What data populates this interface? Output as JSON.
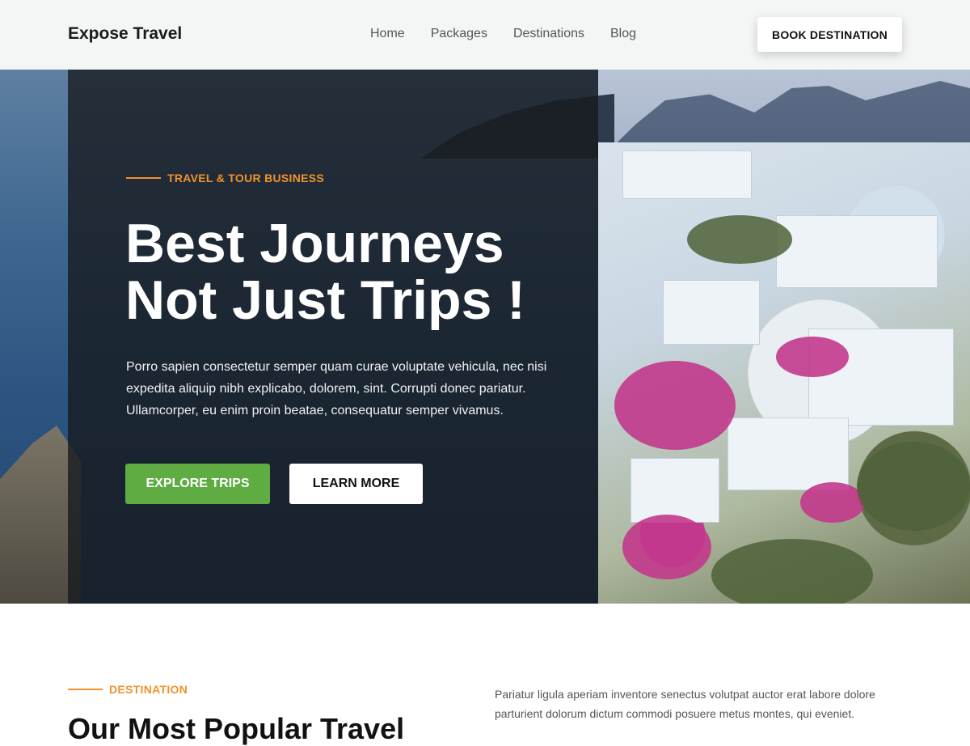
{
  "header": {
    "brand": "Expose Travel",
    "nav": [
      "Home",
      "Packages",
      "Destinations",
      "Blog"
    ],
    "cta": "BOOK DESTINATION"
  },
  "hero": {
    "eyebrow": "TRAVEL & TOUR BUSINESS",
    "title_line1": "Best Journeys",
    "title_line2": "Not Just Trips !",
    "description": "Porro sapien consectetur semper quam curae voluptate vehicula, nec nisi expedita aliquip nibh explicabo, dolorem, sint. Corrupti donec pariatur. Ullamcorper, eu enim proin beatae, consequatur semper vivamus.",
    "primary_button": "EXPLORE TRIPS",
    "secondary_button": "LEARN MORE"
  },
  "destination": {
    "eyebrow": "DESTINATION",
    "title": "Our Most Popular Travel",
    "description": "Pariatur ligula aperiam inventore senectus volutpat auctor erat labore dolore parturient dolorum dictum commodi posuere metus montes, qui eveniet."
  },
  "colors": {
    "accent": "#f0932b",
    "primary_button": "#5fac43",
    "header_bg": "#f3f6f5"
  }
}
